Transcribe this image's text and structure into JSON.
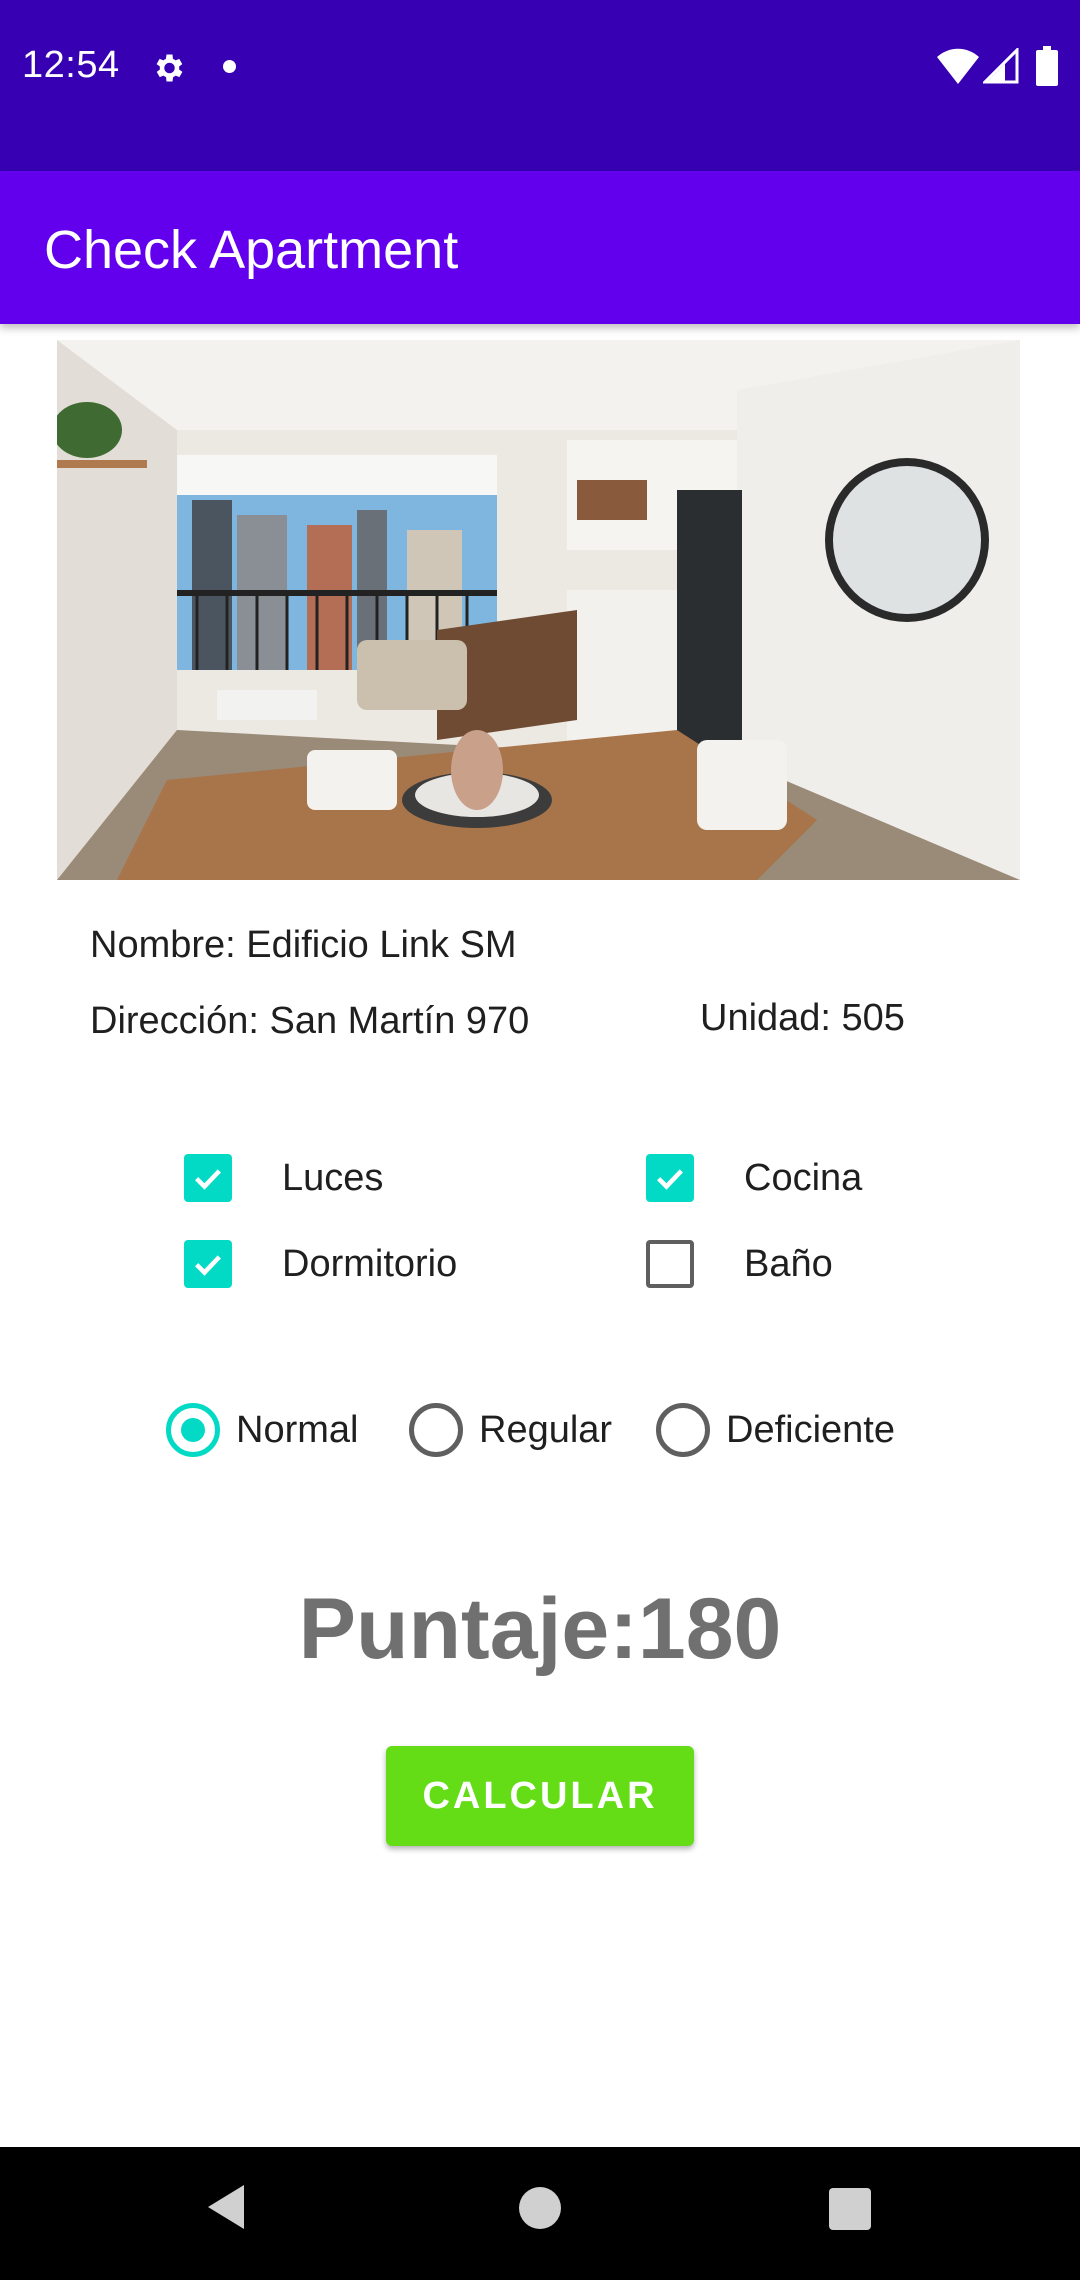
{
  "status_bar": {
    "time": "12:54",
    "icons": [
      "gear-icon",
      "notification-dot-icon",
      "wifi-icon",
      "signal-icon",
      "battery-icon"
    ]
  },
  "app_bar": {
    "title": "Check Apartment"
  },
  "hero": {
    "image": "apartment-interior-photo"
  },
  "info": {
    "name": "Nombre: Edificio Link SM",
    "address": "Dirección: San Martín 970",
    "unit": "Unidad: 505"
  },
  "checkboxes": [
    {
      "label": "Luces",
      "checked": true
    },
    {
      "label": "Cocina",
      "checked": true
    },
    {
      "label": "Dormitorio",
      "checked": true
    },
    {
      "label": "Baño",
      "checked": false
    }
  ],
  "radios": [
    {
      "label": "Normal",
      "selected": true
    },
    {
      "label": "Regular",
      "selected": false
    },
    {
      "label": "Deficiente",
      "selected": false
    }
  ],
  "score": {
    "text": "Puntaje:180"
  },
  "button": {
    "label": "CALCULAR"
  },
  "colors": {
    "status_bar": "#3700b3",
    "app_bar": "#6200ee",
    "accent": "#03dac5",
    "button": "#64dd17",
    "score_text": "#707070"
  },
  "nav_bar": {
    "icons": [
      "back-icon",
      "home-icon",
      "recents-icon"
    ]
  }
}
